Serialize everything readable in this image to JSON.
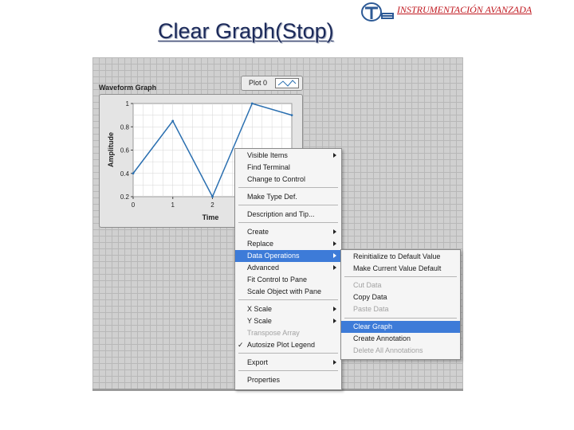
{
  "slide": {
    "title": "Clear Graph(Stop)",
    "brand": "INSTRUMENTACIÓN AVANZADA",
    "logo_icon": "tec-logo-icon"
  },
  "graph": {
    "title": "Waveform Graph",
    "legend_label": "Plot 0",
    "x_axis_label": "Time",
    "y_axis_label": "Amplitude",
    "y_ticks": [
      "1",
      "0.8",
      "0.6",
      "0.4",
      "0.2"
    ],
    "x_ticks": [
      "0",
      "1",
      "2"
    ],
    "colors": {
      "line": "#2a6fb0",
      "plot_bg": "#ffffff",
      "grid": "#d6d6d6"
    }
  },
  "chart_data": {
    "type": "line",
    "x": [
      0,
      1,
      2,
      3,
      4
    ],
    "series": [
      {
        "name": "Plot 0",
        "values": [
          0.4,
          0.85,
          0.2,
          1.0,
          0.9
        ]
      }
    ],
    "xlabel": "Time",
    "ylabel": "Amplitude",
    "xlim": [
      0,
      4
    ],
    "ylim": [
      0.2,
      1
    ],
    "grid": true
  },
  "context_menu": {
    "items": [
      {
        "label": "Visible Items",
        "submenu": true,
        "disabled": false
      },
      {
        "label": "Find Terminal",
        "submenu": false,
        "disabled": false
      },
      {
        "label": "Change to Control",
        "submenu": false,
        "disabled": false
      },
      {
        "label": "Make Type Def.",
        "submenu": false,
        "disabled": false
      },
      {
        "label": "Description and Tip...",
        "submenu": false,
        "disabled": false
      },
      {
        "label": "Create",
        "submenu": true,
        "disabled": false
      },
      {
        "label": "Replace",
        "submenu": true,
        "disabled": false
      },
      {
        "label": "Data Operations",
        "submenu": true,
        "disabled": false,
        "active": true
      },
      {
        "label": "Advanced",
        "submenu": true,
        "disabled": false
      },
      {
        "label": "Fit Control to Pane",
        "submenu": false,
        "disabled": false
      },
      {
        "label": "Scale Object with Pane",
        "submenu": false,
        "disabled": false
      },
      {
        "label": "X Scale",
        "submenu": true,
        "disabled": false
      },
      {
        "label": "Y Scale",
        "submenu": true,
        "disabled": false
      },
      {
        "label": "Transpose Array",
        "submenu": false,
        "disabled": true
      },
      {
        "label": "Autosize Plot Legend",
        "submenu": false,
        "disabled": false,
        "checked": true
      },
      {
        "label": "Export",
        "submenu": true,
        "disabled": false
      },
      {
        "label": "Properties",
        "submenu": false,
        "disabled": false
      }
    ],
    "check_mark": "✓"
  },
  "submenu": {
    "items": [
      {
        "label": "Reinitialize to Default Value",
        "disabled": false
      },
      {
        "label": "Make Current Value Default",
        "disabled": false
      },
      {
        "label": "Cut Data",
        "disabled": true
      },
      {
        "label": "Copy Data",
        "disabled": false
      },
      {
        "label": "Paste Data",
        "disabled": true
      },
      {
        "label": "Clear Graph",
        "disabled": false,
        "active": true
      },
      {
        "label": "Create Annotation",
        "disabled": false
      },
      {
        "label": "Delete All Annotations",
        "disabled": true
      }
    ]
  }
}
